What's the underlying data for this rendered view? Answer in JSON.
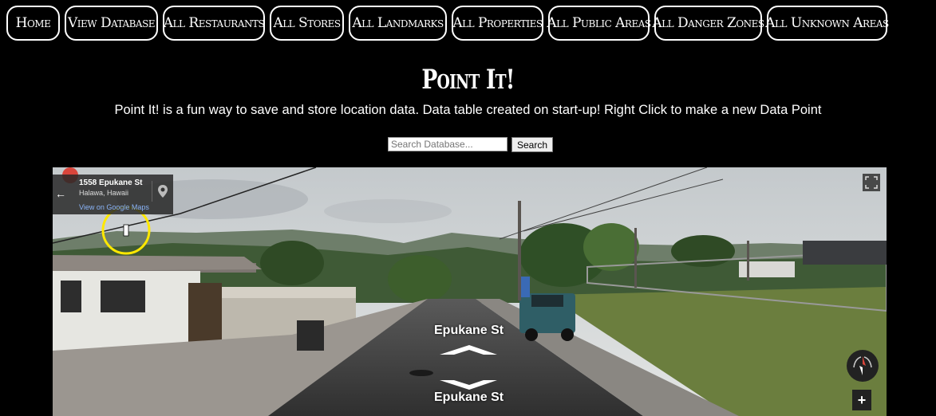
{
  "nav": {
    "items": [
      {
        "label": "Home",
        "width": 67
      },
      {
        "label": "View Database",
        "width": 117
      },
      {
        "label": "All Restaurants",
        "width": 128
      },
      {
        "label": "All Stores",
        "width": 93
      },
      {
        "label": "All Landmarks",
        "width": 123
      },
      {
        "label": "All Properties",
        "width": 115
      },
      {
        "label": "All Public Areas",
        "width": 127
      },
      {
        "label": "All Danger Zones",
        "width": 135
      },
      {
        "label": "All Unknown Areas",
        "width": 151
      }
    ]
  },
  "header": {
    "title": "Point It!",
    "subtitle": "Point It! is a fun way to save and store location data. Data table created on start-up! Right Click to make a new Data Point"
  },
  "search": {
    "placeholder": "Search Database...",
    "button_label": "Search"
  },
  "map": {
    "address": "1558 Epukane St",
    "city": "Halawa, Hawaii",
    "link_text": "View on Google Maps",
    "street_label_forward": "Epukane St",
    "street_label_back": "Epukane St",
    "zoom_in_label": "+"
  }
}
